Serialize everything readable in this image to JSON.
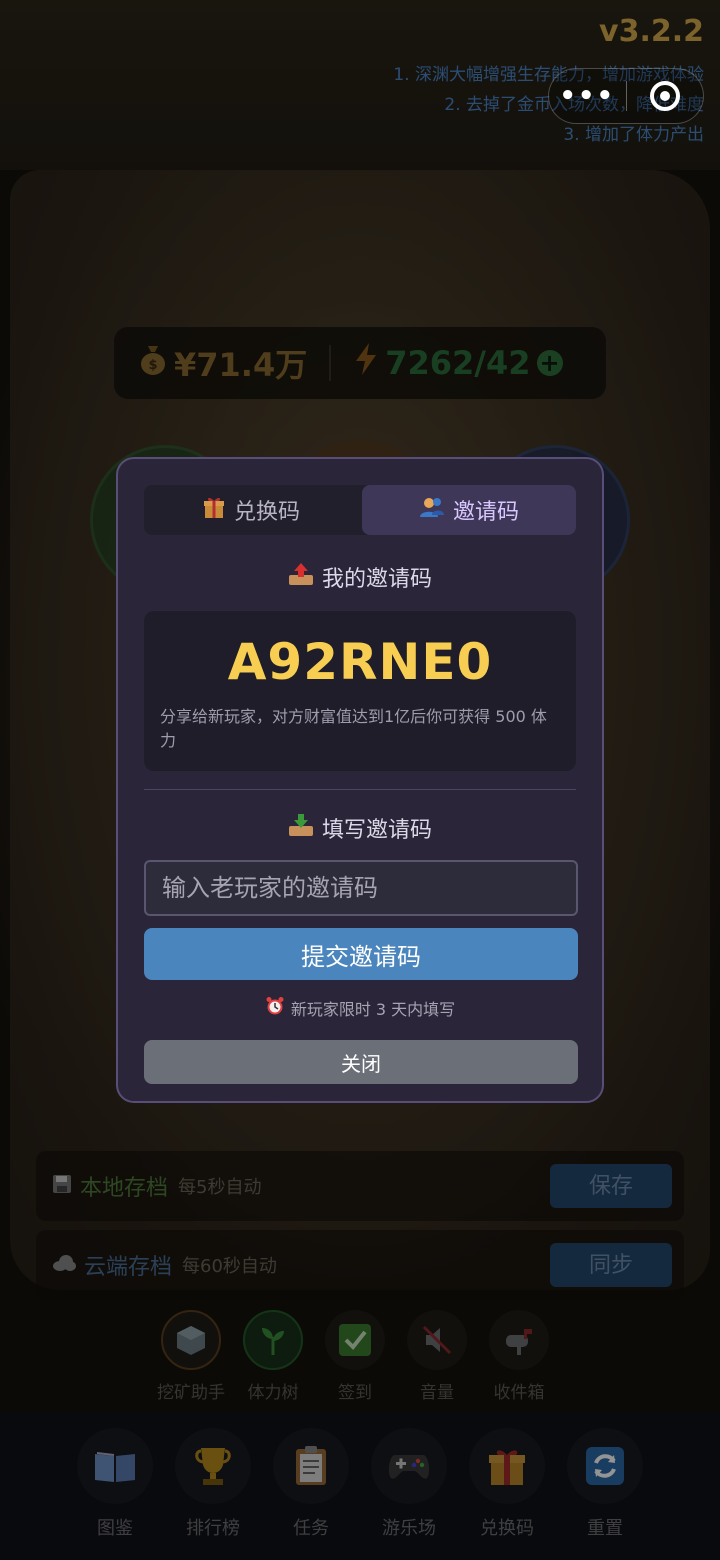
{
  "header": {
    "version": "v3.2.2",
    "notes": [
      "1. 深渊大幅增强生存能力，增加游戏体验",
      "2. 去掉了金币入场次数，降低难度",
      "3. 增加了体力产出"
    ],
    "capsule_more": "•••"
  },
  "stats": {
    "money": "¥71.4万",
    "energy": "7262/42"
  },
  "saves": [
    {
      "title": "本地存档",
      "sub": "每5秒自动",
      "button": "保存",
      "title_color": "#4f7a3c"
    },
    {
      "title": "云端存档",
      "sub": "每60秒自动",
      "button": "同步",
      "title_color": "#4a6f94"
    }
  ],
  "tools": [
    {
      "label": "挖矿助手",
      "icon": "cube-icon"
    },
    {
      "label": "体力树",
      "icon": "sprout-icon"
    },
    {
      "label": "签到",
      "icon": "checkbox-icon"
    },
    {
      "label": "音量",
      "icon": "mute-icon"
    },
    {
      "label": "收件箱",
      "icon": "mailbox-icon"
    }
  ],
  "bottom_nav": [
    {
      "label": "图鉴",
      "icon": "book-icon"
    },
    {
      "label": "排行榜",
      "icon": "trophy-icon"
    },
    {
      "label": "任务",
      "icon": "clipboard-icon"
    },
    {
      "label": "游乐场",
      "icon": "gamepad-icon"
    },
    {
      "label": "兑换码",
      "icon": "gift-icon"
    },
    {
      "label": "重置",
      "icon": "refresh-icon"
    }
  ],
  "modal": {
    "tabs": [
      {
        "label": "兑换码",
        "icon": "gift-icon"
      },
      {
        "label": "邀请码",
        "icon": "users-icon",
        "active": true
      }
    ],
    "my_code_title": "我的邀请码",
    "my_code": "A92RNE0",
    "my_code_desc": "分享给新玩家，对方财富值达到1亿后你可获得 500 体力",
    "fill_title": "填写邀请码",
    "input_placeholder": "输入老玩家的邀请码",
    "submit_label": "提交邀请码",
    "hint": "新玩家限时 3 天内填写",
    "close_label": "关闭"
  }
}
